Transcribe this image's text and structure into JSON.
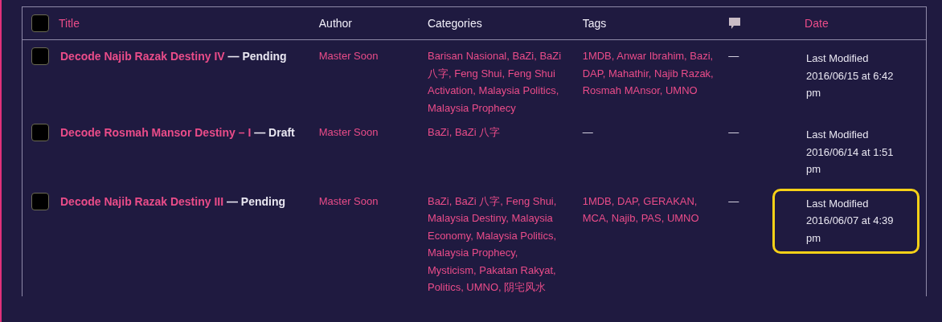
{
  "columns": [
    {
      "label": "Title",
      "sortable": true,
      "kind": "text"
    },
    {
      "label": "Author",
      "sortable": false,
      "kind": "text"
    },
    {
      "label": "Categories",
      "sortable": false,
      "kind": "text"
    },
    {
      "label": "Tags",
      "sortable": false,
      "kind": "text"
    },
    {
      "kind": "comments-icon"
    },
    {
      "label": "Date",
      "sortable": true,
      "kind": "text"
    }
  ],
  "select_all": {
    "checked": false
  },
  "rows": [
    {
      "checked": false,
      "title": "Decode Najib Razak Destiny IV",
      "status": "— Pending",
      "author": "Master Soon",
      "categories": {
        "kind": "links",
        "text": "Barisan Nasional, BaZi, BaZi 八字, Feng Shui, Feng Shui Activation, Malaysia Politics, Malaysia Prophecy"
      },
      "tags": {
        "kind": "links",
        "text": "1MDB, Anwar Ibrahim, Bazi, DAP, Mahathir, Najib Razak, Rosmah MAnsor, UMNO"
      },
      "comments": "—",
      "date_label": "Last Modified",
      "date": "2016/06/15 at 6:42 pm",
      "highlighted": false
    },
    {
      "checked": false,
      "title": "Decode Rosmah Mansor Destiny – I",
      "status": "— Draft",
      "author": "Master Soon",
      "categories": {
        "kind": "links",
        "text": "BaZi, BaZi 八字"
      },
      "tags": {
        "kind": "none",
        "text": "—"
      },
      "comments": "—",
      "date_label": "Last Modified",
      "date": "2016/06/14 at 1:51 pm",
      "highlighted": false
    },
    {
      "checked": false,
      "title": "Decode Najib Razak Destiny III",
      "status": "— Pending",
      "author": "Master Soon",
      "categories": {
        "kind": "links",
        "text": "BaZi, BaZi 八字, Feng Shui, Malaysia Destiny, Malaysia Economy, Malaysia Politics, Malaysia Prophecy, Mysticism, Pakatan Rakyat, Politics, UMNO, 阴宅风水"
      },
      "tags": {
        "kind": "links",
        "text": "1MDB, DAP, GERAKAN, MCA, Najib, PAS, UMNO"
      },
      "comments": "—",
      "date_label": "Last Modified",
      "date": "2016/06/07 at 4:39 pm",
      "highlighted": true
    }
  ]
}
